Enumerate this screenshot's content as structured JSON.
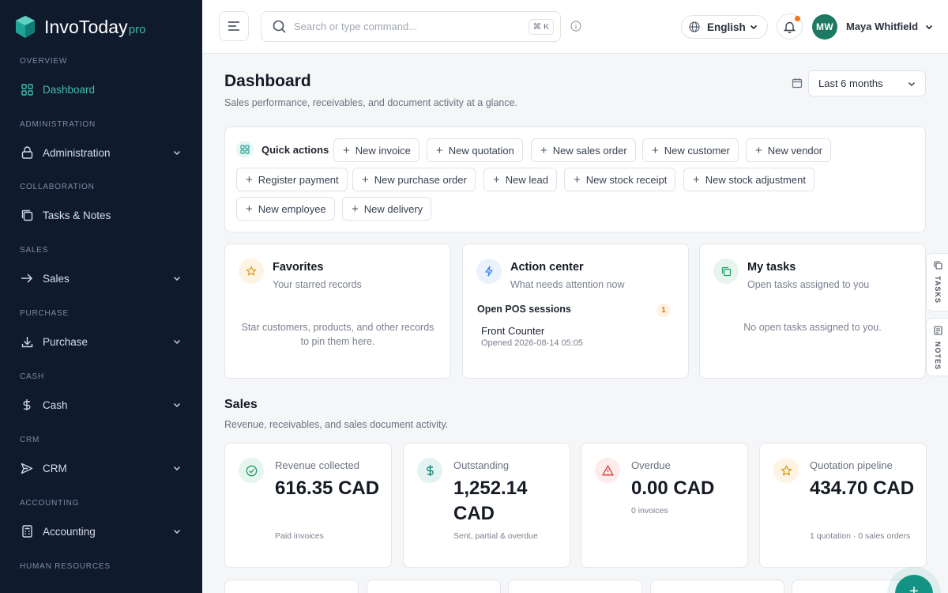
{
  "brand": {
    "name": "InvoToday",
    "suffix": "pro",
    "accent": "#43b6a8"
  },
  "sidebar": {
    "sections": [
      {
        "heading": "OVERVIEW",
        "item": "Dashboard",
        "icon": "grid-icon",
        "active": true,
        "expandable": false
      },
      {
        "heading": "ADMINISTRATION",
        "item": "Administration",
        "icon": "lock-icon",
        "expandable": true
      },
      {
        "heading": "COLLABORATION",
        "item": "Tasks & Notes",
        "icon": "copy-icon",
        "expandable": false
      },
      {
        "heading": "SALES",
        "item": "Sales",
        "icon": "arrow-right-icon",
        "expandable": true
      },
      {
        "heading": "PURCHASE",
        "item": "Purchase",
        "icon": "download-icon",
        "expandable": true
      },
      {
        "heading": "CASH",
        "item": "Cash",
        "icon": "dollar-icon",
        "expandable": true
      },
      {
        "heading": "CRM",
        "item": "CRM",
        "icon": "send-icon",
        "expandable": true
      },
      {
        "heading": "ACCOUNTING",
        "item": "Accounting",
        "icon": "calculator-icon",
        "expandable": true
      },
      {
        "heading": "HUMAN RESOURCES"
      }
    ]
  },
  "topbar": {
    "search_placeholder": "Search or type command...",
    "shortcut": "⌘ K",
    "language": "English",
    "user": {
      "initials": "MW",
      "name": "Maya Whitfield"
    }
  },
  "header": {
    "title": "Dashboard",
    "subtitle": "Sales performance, receivables, and document activity at a glance.",
    "range": "Last 6 months"
  },
  "quick_actions": {
    "label": "Quick actions",
    "rows": [
      [
        "New invoice",
        "New quotation",
        "New sales order",
        "New customer",
        "New vendor"
      ],
      [
        "Register payment",
        "New purchase order",
        "New lead",
        "New stock receipt",
        "New stock adjustment"
      ],
      [
        "New employee",
        "New delivery"
      ]
    ]
  },
  "panels": {
    "favorites": {
      "title": "Favorites",
      "subtitle": "Your starred records",
      "empty": "Star customers, products, and other records to pin them here."
    },
    "action_center": {
      "title": "Action center",
      "subtitle": "What needs attention now",
      "section": "Open POS sessions",
      "count": "1",
      "session_name": "Front Counter",
      "session_opened": "Opened 2026-08-14 05:05"
    },
    "tasks": {
      "title": "My tasks",
      "subtitle": "Open tasks assigned to you",
      "empty": "No open tasks assigned to you."
    }
  },
  "sales": {
    "title": "Sales",
    "subtitle": "Revenue, receivables, and sales document activity.",
    "stats": [
      {
        "label": "Revenue collected",
        "value": "616.35 CAD",
        "note": "Paid invoices",
        "icon": "check-circle-icon",
        "color": "#1b9a6c"
      },
      {
        "label": "Outstanding",
        "value": "1,252.14 CAD",
        "note": "Sent, partial & overdue",
        "icon": "dollar-icon",
        "color": "#14877a"
      },
      {
        "label": "Overdue",
        "value": "0.00 CAD",
        "note": "0 invoices",
        "icon": "warning-icon",
        "color": "#dc3b3b"
      },
      {
        "label": "Quotation pipeline",
        "value": "434.70 CAD",
        "note": "1 quotation · 0 sales orders",
        "icon": "star-icon",
        "color": "#d99a19"
      }
    ]
  },
  "side_tabs": [
    "TASKS",
    "NOTES"
  ],
  "fab": "+"
}
